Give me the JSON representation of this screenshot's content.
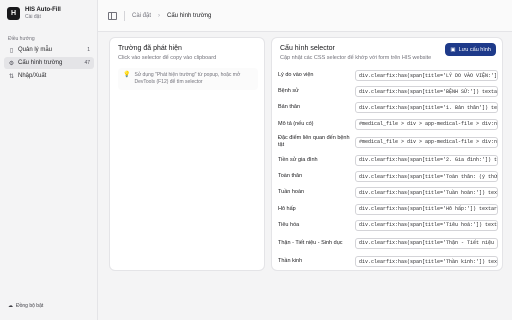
{
  "app": {
    "name": "HIS Auto-Fill",
    "subtitle": "Cài đặt",
    "logo_glyph": "H"
  },
  "sidebar": {
    "section_label": "Điều hướng",
    "items": [
      {
        "icon": "document-icon",
        "label": "Quản lý mẫu",
        "count": "1",
        "active": false
      },
      {
        "icon": "gear-icon",
        "label": "Cấu hình trường",
        "count": "47",
        "active": true
      },
      {
        "icon": "import-export-icon",
        "label": "Nhập/Xuất",
        "count": "",
        "active": false
      }
    ],
    "sync_label": "Đồng bộ bật"
  },
  "topbar": {
    "breadcrumb": [
      "Cài đặt",
      "Cấu hình trường"
    ],
    "separator": "›"
  },
  "detected_panel": {
    "title": "Trường đã phát hiện",
    "subtitle": "Click vào selector để copy vào clipboard",
    "hint": "Sử dụng \"Phát hiện trường\" từ popup, hoặc mở DevTools (F12) để tìm selector"
  },
  "selector_panel": {
    "title": "Cấu hình selector",
    "subtitle": "Cập nhật các CSS selector để khớp với form trên HIS website",
    "save_label": "Lưu cấu hình",
    "rows": [
      {
        "label": "Lý do vào viện",
        "value": "div.clearfix:has(span[title='LÝ DO VÀO VIỆN:']) textarea"
      },
      {
        "label": "Bệnh sử",
        "value": "div.clearfix:has(span[title='BỆNH SỬ:']) textarea.form"
      },
      {
        "label": "Bản thân",
        "value": "div.clearfix:has(span[title='1. Bản thân']) textarea.form"
      },
      {
        "label": "Mô tả (nếu có)",
        "value": "#medical_file > div > app-medical-file > div:nth-child"
      },
      {
        "label": "Đặc điểm liên quan đến bệnh tật",
        "value": "#medical_file > div > app-medical-file > div:nth-child"
      },
      {
        "label": "Tiền sử gia đình",
        "value": "div.clearfix:has(span[title='2. Gia đình:']) textarea.form"
      },
      {
        "label": "Toàn thân",
        "value": "div.clearfix:has(span[title='Toàn thân: (ý thức, da niêm"
      },
      {
        "label": "Tuần hoàn",
        "value": "div.clearfix:has(span[title='Tuần hoàn:']) textarea.form"
      },
      {
        "label": "Hô hấp",
        "value": "div.clearfix:has(span[title='Hô hấp:']) textarea.form-c"
      },
      {
        "label": "Tiêu hóa",
        "value": "div.clearfix:has(span[title='Tiêu hoá:']) textarea.form-"
      },
      {
        "label": "Thận - Tiết niệu - Sinh dục",
        "value": "div.clearfix:has(span[title='Thận - Tiết niệu - Sinh dục"
      },
      {
        "label": "Thần kinh",
        "value": "div.clearfix:has(span[title='Thần kinh:']) textarea.form"
      }
    ]
  },
  "colors": {
    "accent": "#1e3a8a",
    "hint_icon": "#ca8a04"
  }
}
